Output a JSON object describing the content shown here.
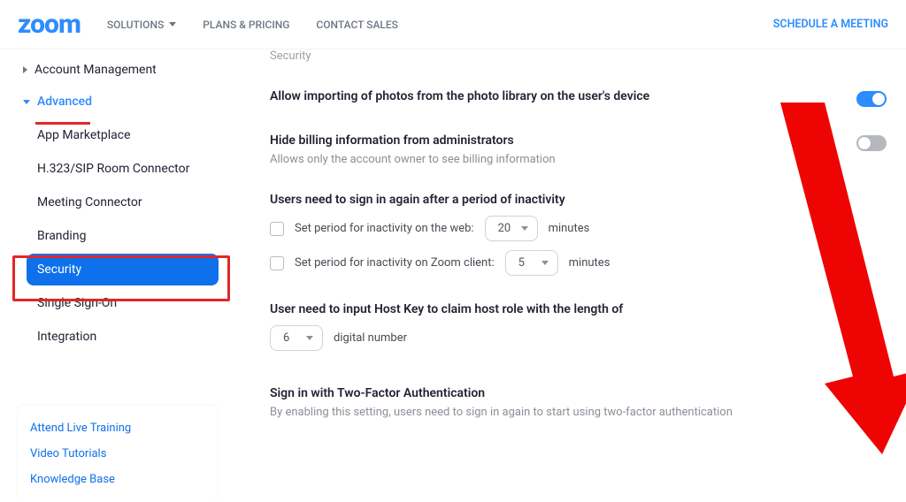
{
  "topbar": {
    "logo": "zoom",
    "nav": {
      "solutions": "SOLUTIONS",
      "plans": "PLANS & PRICING",
      "contact": "CONTACT SALES"
    },
    "cta": "SCHEDULE A MEETING"
  },
  "sidebar": {
    "account_mgmt": "Account Management",
    "advanced": "Advanced",
    "items": {
      "marketplace": "App Marketplace",
      "h323": "H.323/SIP Room Connector",
      "meeting_connector": "Meeting Connector",
      "branding": "Branding",
      "security": "Security",
      "sso": "Single Sign-On",
      "integration": "Integration"
    },
    "help": {
      "training": "Attend Live Training",
      "videos": "Video Tutorials",
      "kb": "Knowledge Base"
    }
  },
  "main": {
    "crumb": "Security",
    "photo_import": {
      "title": "Allow importing of photos from the photo library on the user's device"
    },
    "billing": {
      "title": "Hide billing information from administrators",
      "desc": "Allows only the account owner to see billing information"
    },
    "inactivity": {
      "title": "Users need to sign in again after a period of inactivity",
      "web_label": "Set period for inactivity on the web:",
      "web_value": "20",
      "client_label": "Set period for inactivity on Zoom client:",
      "client_value": "5",
      "unit": "minutes"
    },
    "hostkey": {
      "title": "User need to input Host Key to claim host role with the length of",
      "value": "6",
      "unit": "digital number"
    },
    "twofa": {
      "title": "Sign in with Two-Factor Authentication",
      "desc": "By enabling this setting, users need to sign in again to start using two-factor authentication"
    }
  }
}
